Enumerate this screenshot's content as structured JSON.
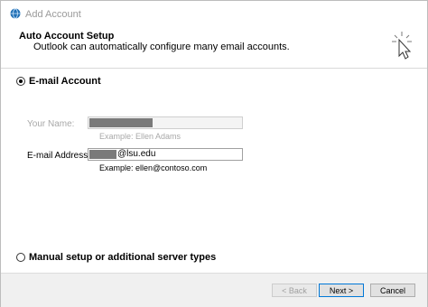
{
  "window": {
    "title": "Add Account"
  },
  "header": {
    "title": "Auto Account Setup",
    "subtitle": "Outlook can automatically configure many email accounts."
  },
  "email_account": {
    "label": "E-mail Account",
    "selected": true,
    "your_name": {
      "label": "Your Name:",
      "example": "Example: Ellen Adams",
      "disabled": true
    },
    "email_address": {
      "label": "E-mail Address:",
      "value_suffix": "@lsu.edu",
      "example": "Example: ellen@contoso.com"
    }
  },
  "manual_setup": {
    "label": "Manual setup or additional server types",
    "selected": false
  },
  "footer": {
    "back_label": "< Back",
    "next_label": "Next >",
    "cancel_label": "Cancel"
  },
  "icons": {
    "app": "outlook-globe-icon",
    "header": "cursor-sparkle-icon"
  },
  "colors": {
    "default_button_border": "#0078d7",
    "redaction": "#7a7a7a"
  }
}
